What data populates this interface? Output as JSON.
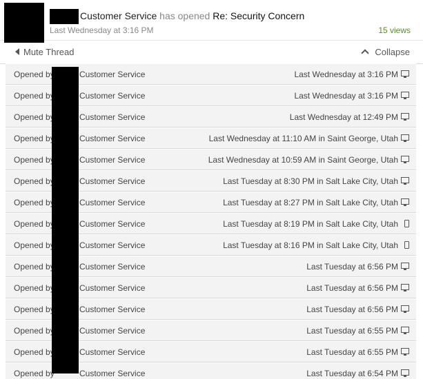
{
  "header": {
    "user": "Customer Service",
    "action": "has opened",
    "subject": "Re: Security Concern",
    "time": "Last Wednesday at 3:16 PM",
    "views": "15 views"
  },
  "toolbar": {
    "mute_label": "Mute Thread",
    "collapse_label": "Collapse"
  },
  "rows": [
    {
      "opened": "Opened by",
      "who": "Customer Service",
      "when": "Last Wednesday at 3:16 PM",
      "device": "desktop-icon"
    },
    {
      "opened": "Opened by",
      "who": "Customer Service",
      "when": "Last Wednesday at 3:16 PM",
      "device": "desktop-icon"
    },
    {
      "opened": "Opened by",
      "who": "Customer Service",
      "when": "Last Wednesday at 12:49 PM",
      "device": "desktop-icon"
    },
    {
      "opened": "Opened by",
      "who": "Customer Service",
      "when": "Last Wednesday at 11:10 AM in Saint George, Utah",
      "device": "desktop-icon"
    },
    {
      "opened": "Opened by",
      "who": "Customer Service",
      "when": "Last Wednesday at 10:59 AM in Saint George, Utah",
      "device": "desktop-icon"
    },
    {
      "opened": "Opened by",
      "who": "Customer Service",
      "when": "Last Tuesday at 8:30 PM in Salt Lake City, Utah",
      "device": "desktop-icon"
    },
    {
      "opened": "Opened by",
      "who": "Customer Service",
      "when": "Last Tuesday at 8:27 PM in Salt Lake City, Utah",
      "device": "desktop-icon"
    },
    {
      "opened": "Opened by",
      "who": "Customer Service",
      "when": "Last Tuesday at 8:19 PM in Salt Lake City, Utah",
      "device": "phone-icon"
    },
    {
      "opened": "Opened by",
      "who": "Customer Service",
      "when": "Last Tuesday at 8:16 PM in Salt Lake City, Utah",
      "device": "phone-icon"
    },
    {
      "opened": "Opened by",
      "who": "Customer Service",
      "when": "Last Tuesday at 6:56 PM",
      "device": "desktop-icon"
    },
    {
      "opened": "Opened by",
      "who": "Customer Service",
      "when": "Last Tuesday at 6:56 PM",
      "device": "desktop-icon"
    },
    {
      "opened": "Opened by",
      "who": "Customer Service",
      "when": "Last Tuesday at 6:56 PM",
      "device": "desktop-icon"
    },
    {
      "opened": "Opened by",
      "who": "Customer Service",
      "when": "Last Tuesday at 6:55 PM",
      "device": "desktop-icon"
    },
    {
      "opened": "Opened by",
      "who": "Customer Service",
      "when": "Last Tuesday at 6:55 PM",
      "device": "desktop-icon"
    },
    {
      "opened": "Opened by",
      "who": "Customer Service",
      "when": "Last Tuesday at 6:54 PM",
      "device": "desktop-icon"
    }
  ],
  "colors": {
    "views": "#5a8a2a",
    "row_bg": "#f3f3f3",
    "redaction": "#000000"
  }
}
